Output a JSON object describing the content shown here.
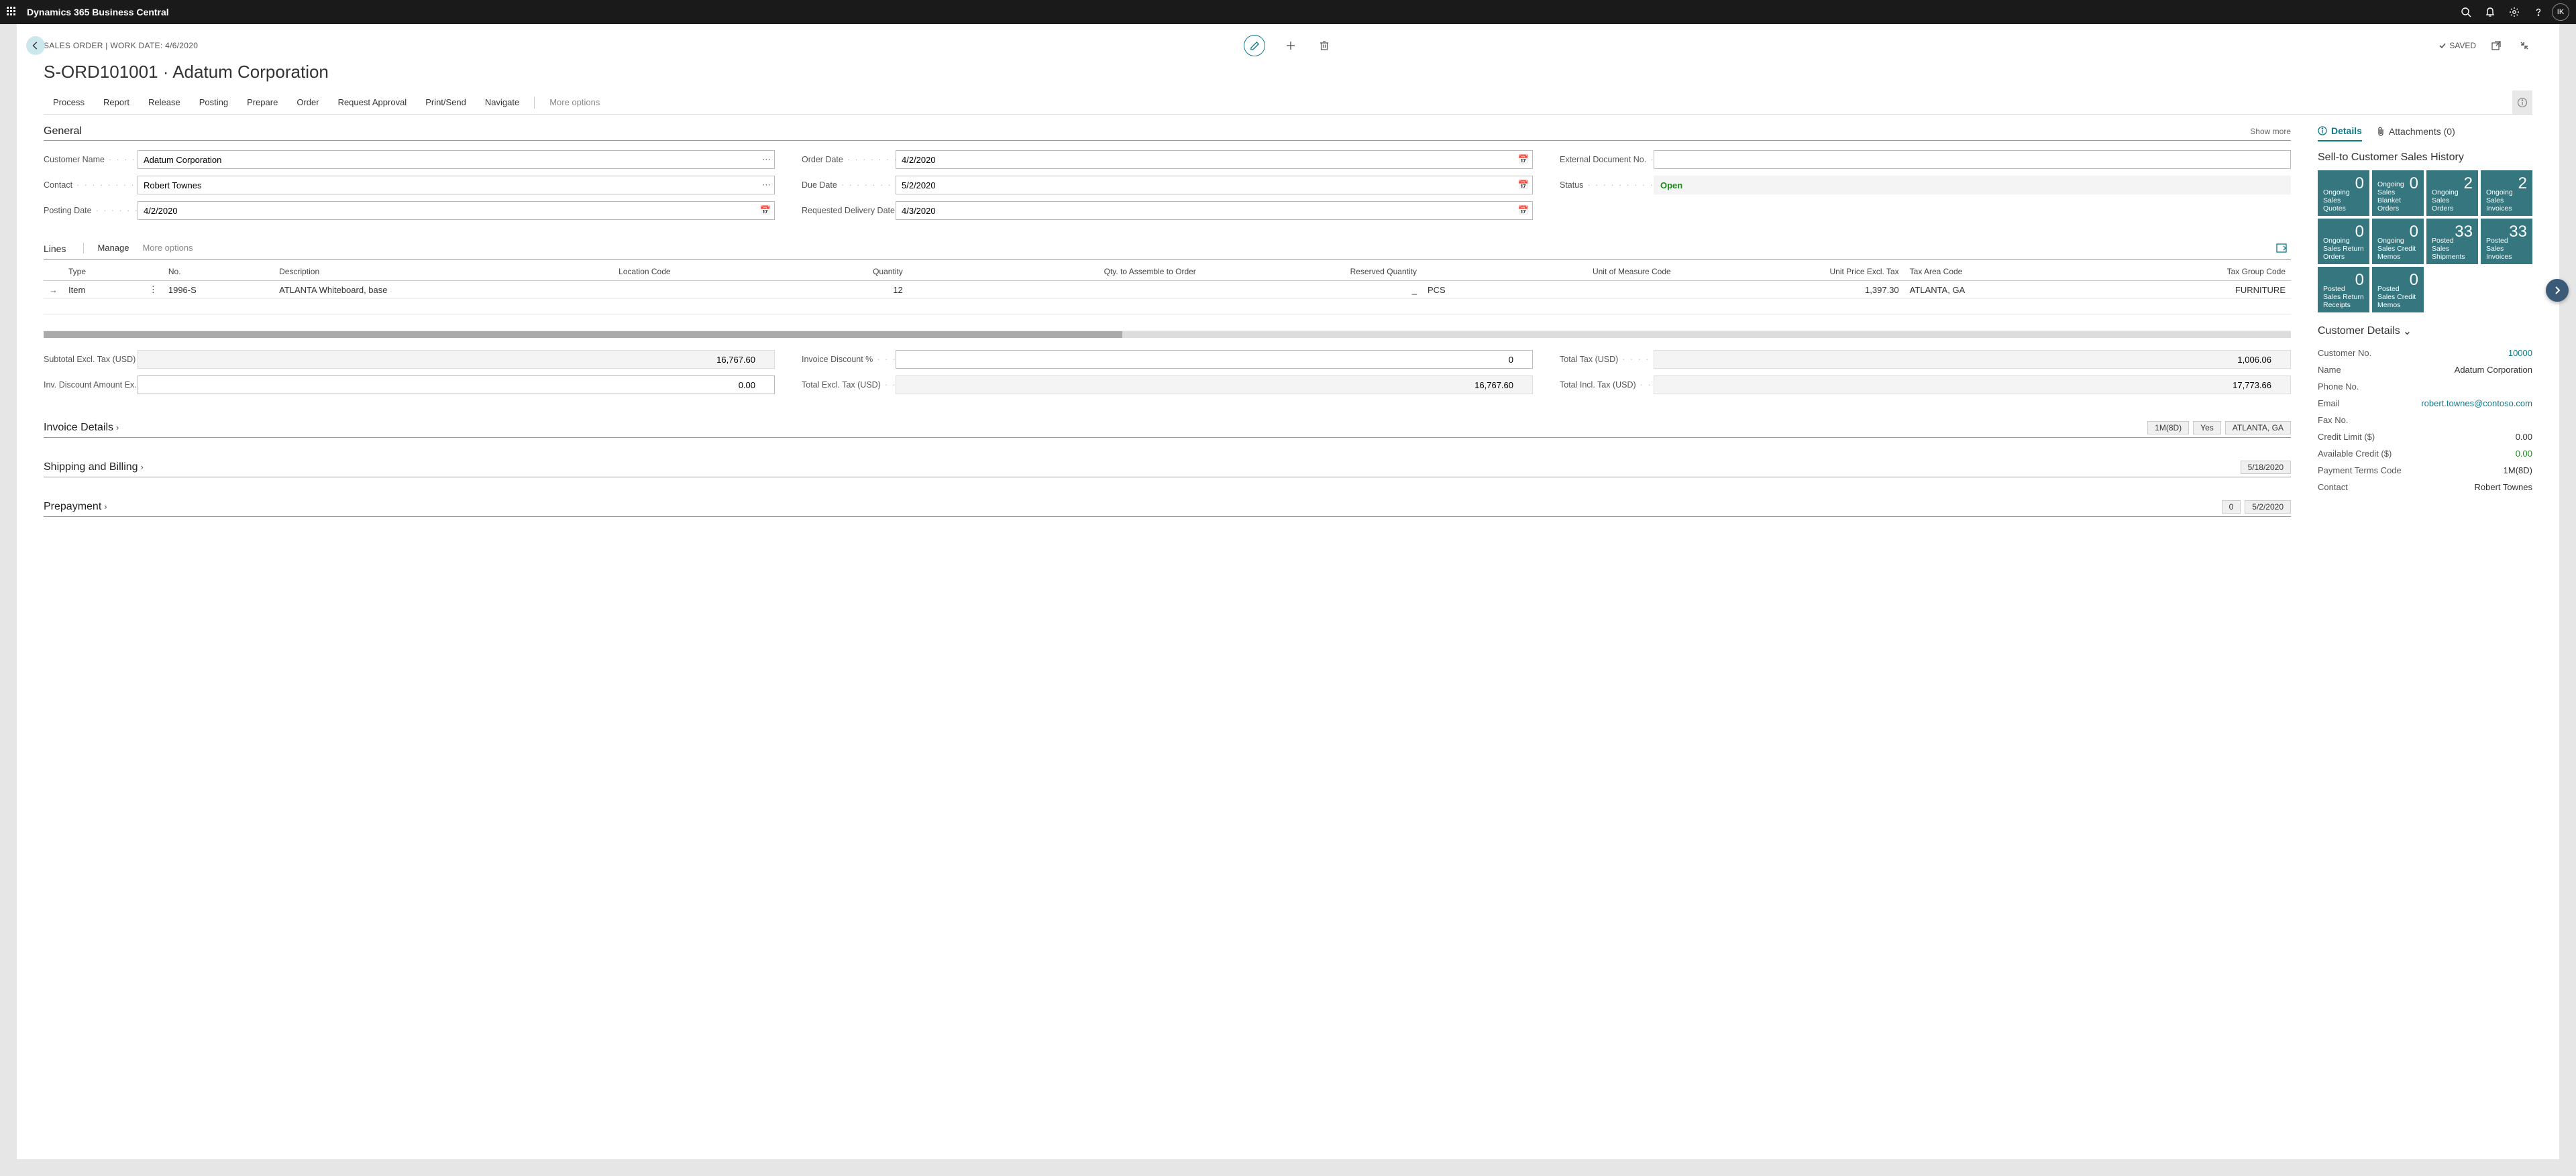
{
  "topbar": {
    "app_title": "Dynamics 365 Business Central",
    "avatar_initials": "IK"
  },
  "header": {
    "breadcrumb": "SALES ORDER | WORK DATE: 4/6/2020",
    "page_title": "S-ORD101001 · Adatum Corporation",
    "saved_label": "SAVED"
  },
  "actions": {
    "items": [
      "Process",
      "Report",
      "Release",
      "Posting",
      "Prepare",
      "Order",
      "Request Approval",
      "Print/Send",
      "Navigate"
    ],
    "more": "More options"
  },
  "general": {
    "section_title": "General",
    "show_more": "Show more",
    "customer_name_label": "Customer Name",
    "customer_name": "Adatum Corporation",
    "contact_label": "Contact",
    "contact": "Robert Townes",
    "posting_date_label": "Posting Date",
    "posting_date": "4/2/2020",
    "order_date_label": "Order Date",
    "order_date": "4/2/2020",
    "due_date_label": "Due Date",
    "due_date": "5/2/2020",
    "requested_delivery_label": "Requested Delivery Date",
    "requested_delivery": "4/3/2020",
    "external_doc_label": "External Document No.",
    "external_doc": "",
    "status_label": "Status",
    "status_value": "Open"
  },
  "lines": {
    "tab": "Lines",
    "manage": "Manage",
    "more": "More options",
    "columns": {
      "type": "Type",
      "no": "No.",
      "description": "Description",
      "location_code": "Location Code",
      "quantity": "Quantity",
      "qty_to_assemble": "Qty. to Assemble to Order",
      "reserved_qty": "Reserved Quantity",
      "uom": "Unit of Measure Code",
      "unit_price": "Unit Price Excl. Tax",
      "tax_area": "Tax Area Code",
      "tax_group": "Tax Group Code"
    },
    "rows": [
      {
        "type": "Item",
        "no": "1996-S",
        "description": "ATLANTA Whiteboard, base",
        "location_code": "",
        "quantity": "12",
        "qty_to_assemble": "",
        "reserved_qty": "_",
        "uom": "PCS",
        "unit_price": "1,397.30",
        "tax_area": "ATLANTA, GA",
        "tax_group": "FURNITURE"
      }
    ]
  },
  "totals": {
    "subtotal_label": "Subtotal Excl. Tax (USD)",
    "subtotal": "16,767.60",
    "inv_disc_amt_label": "Inv. Discount Amount Ex...",
    "inv_disc_amt": "0.00",
    "inv_disc_pct_label": "Invoice Discount %",
    "inv_disc_pct": "0",
    "total_excl_label": "Total Excl. Tax (USD)",
    "total_excl": "16,767.60",
    "total_tax_label": "Total Tax (USD)",
    "total_tax": "1,006.06",
    "total_incl_label": "Total Incl. Tax (USD)",
    "total_incl": "17,773.66"
  },
  "collapsed_sections": {
    "invoice_details": {
      "title": "Invoice Details",
      "tags": [
        "1M(8D)",
        "Yes",
        "ATLANTA, GA"
      ]
    },
    "shipping_billing": {
      "title": "Shipping and Billing",
      "tags": [
        "5/18/2020"
      ]
    },
    "prepayment": {
      "title": "Prepayment",
      "tags": [
        "0",
        "5/2/2020"
      ]
    }
  },
  "side": {
    "tabs": {
      "details": "Details",
      "attachments": "Attachments (0)"
    },
    "history_title": "Sell-to Customer Sales History",
    "tiles": [
      {
        "num": "0",
        "label": "Ongoing Sales Quotes"
      },
      {
        "num": "0",
        "label": "Ongoing Sales Blanket Orders"
      },
      {
        "num": "2",
        "label": "Ongoing Sales Orders"
      },
      {
        "num": "2",
        "label": "Ongoing Sales Invoices"
      },
      {
        "num": "0",
        "label": "Ongoing Sales Return Orders"
      },
      {
        "num": "0",
        "label": "Ongoing Sales Credit Memos"
      },
      {
        "num": "33",
        "label": "Posted Sales Shipments"
      },
      {
        "num": "33",
        "label": "Posted Sales Invoices"
      },
      {
        "num": "0",
        "label": "Posted Sales Return Receipts"
      },
      {
        "num": "0",
        "label": "Posted Sales Credit Memos"
      }
    ],
    "cust_details_title": "Customer Details",
    "cust": {
      "customer_no_k": "Customer No.",
      "customer_no_v": "10000",
      "name_k": "Name",
      "name_v": "Adatum Corporation",
      "phone_k": "Phone No.",
      "phone_v": "",
      "email_k": "Email",
      "email_v": "robert.townes@contoso.com",
      "fax_k": "Fax No.",
      "fax_v": "",
      "credit_limit_k": "Credit Limit ($)",
      "credit_limit_v": "0.00",
      "avail_credit_k": "Available Credit ($)",
      "avail_credit_v": "0.00",
      "payment_terms_k": "Payment Terms Code",
      "payment_terms_v": "1M(8D)",
      "contact_k": "Contact",
      "contact_v": "Robert Townes"
    }
  }
}
